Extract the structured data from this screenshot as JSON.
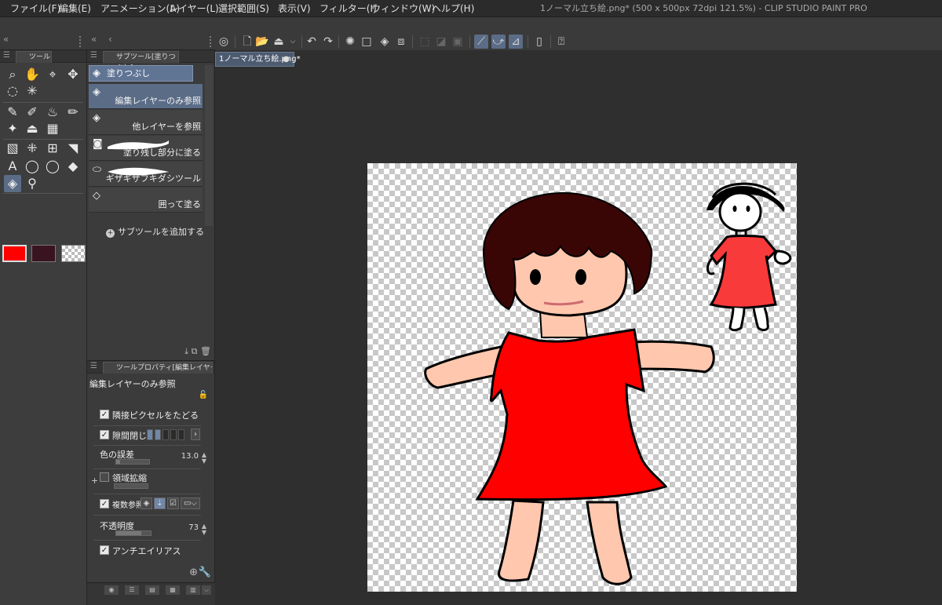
{
  "menu": {
    "items": [
      "ファイル(F)",
      "編集(E)",
      "アニメーション(A)",
      "レイヤー(L)",
      "選択範囲(S)",
      "表示(V)",
      "フィルター(I)",
      "ウィンドウ(W)",
      "ヘルプ(H)"
    ],
    "window_title": "1ノーマル立ち絵.png* (500 x 500px 72dpi 121.5%)  - CLIP STUDIO PAINT PRO"
  },
  "tool_panel": {
    "tab_label": "ツール",
    "main_color": "#ff0000",
    "sub_color": "#3a1320",
    "tools": [
      "zoom-icon",
      "hand-icon",
      "operation-icon",
      "move-icon",
      "lasso-icon",
      "magic-wand-icon",
      "pen-icon",
      "pencil-icon",
      "brush-icon",
      "airbrush-icon",
      "decoration-icon",
      "stamp-icon",
      "figure-icon",
      "gradient-icon",
      "frame-icon",
      "ruler-icon",
      "text-icon",
      "balloon-icon",
      "eraser-icon",
      "fill-icon",
      "eyedropper-icon"
    ]
  },
  "subtool_panel": {
    "tab_label": "サブツール[塗りつぶし]",
    "group_label": "塗りつぶし",
    "subtools": [
      {
        "label": "編集レイヤーのみ参照",
        "selected": true
      },
      {
        "label": "他レイヤーを参照",
        "selected": false
      },
      {
        "label": "塗り残し部分に塗る",
        "selected": false
      },
      {
        "label": "ギザギザフキダシツール",
        "selected": false
      },
      {
        "label": "囲って塗る",
        "selected": false
      }
    ],
    "add_label": "サブツールを追加する"
  },
  "property_panel": {
    "tab_label": "ツールプロパティ[編集レイヤーのみ",
    "title": "編集レイヤーのみ参照",
    "rows": {
      "adjacent": {
        "label": "隣接ピクセルをたどる",
        "checked": true
      },
      "gap": {
        "label": "隙間閉じ",
        "checked": true
      },
      "tolerance": {
        "label": "色の誤差",
        "value": "13.0",
        "level": 0.13
      },
      "expand": {
        "label": "領域拡縮",
        "checked": false
      },
      "multi_ref": {
        "label": "複数参照",
        "checked": true
      },
      "opacity": {
        "label": "不透明度",
        "value": "73",
        "level": 0.73
      },
      "antialias": {
        "label": "アンチエイリアス",
        "checked": true
      }
    }
  },
  "document": {
    "tab_label": "1ノーマル立ち絵.png*",
    "colors": {
      "dress": "#ff0000",
      "skin": "#ffc7ae",
      "hair": "#3a0505",
      "small_dress": "#f83a3a"
    }
  }
}
